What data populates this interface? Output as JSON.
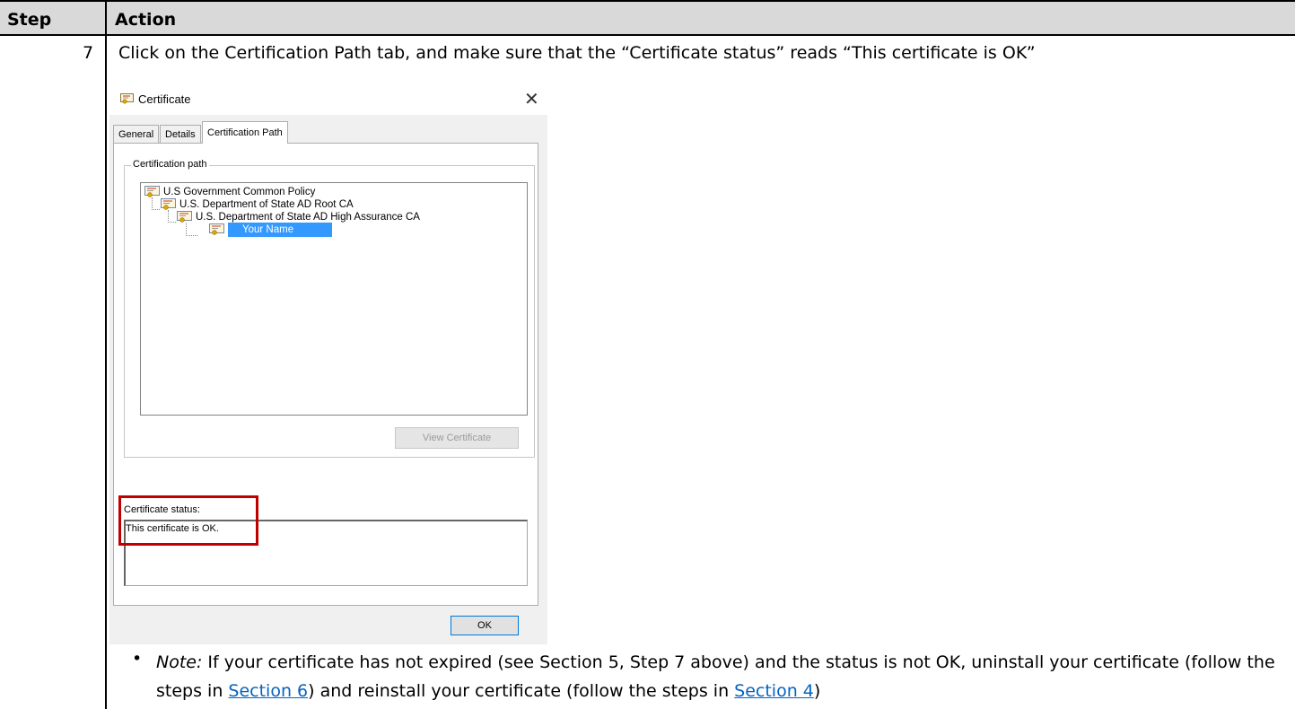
{
  "table": {
    "header": {
      "step": "Step",
      "action": "Action"
    },
    "row": {
      "step": "7",
      "instruction": "Click on the Certification Path tab, and make sure that the “Certificate status” reads “This certificate is OK”"
    }
  },
  "dialog": {
    "title": "Certificate",
    "close_glyph": "✕",
    "tabs": [
      {
        "label": "General",
        "active": false
      },
      {
        "label": "Details",
        "active": false
      },
      {
        "label": "Certification Path",
        "active": true
      }
    ],
    "group_label": "Certification path",
    "tree": [
      {
        "label": "U.S Government Common Policy",
        "level": 0
      },
      {
        "label": "U.S. Department of State AD Root CA",
        "level": 1
      },
      {
        "label": "U.S. Department of State AD High Assurance CA",
        "level": 2
      },
      {
        "label": "Your Name",
        "level": 3,
        "selected": true
      }
    ],
    "view_certificate_button": "View Certificate",
    "status_label": "Certificate status:",
    "status_text": "This certificate is OK.",
    "ok_button": "OK",
    "highlight_color": "#c00000",
    "selection_color": "#3399ff"
  },
  "note": {
    "bullet": "•",
    "prefix": "Note:",
    "text_1": " If your certificate has not expired (see Section 5, Step 7 above) and the status is not OK, uninstall your certificate (follow the steps in ",
    "link_1": "Section 6",
    "text_2": ") and reinstall your certificate (follow the steps in ",
    "link_2": "Section 4",
    "text_3": ")",
    "link_color": "#0563c1"
  },
  "icons": {
    "certificate": "certificate-icon"
  }
}
